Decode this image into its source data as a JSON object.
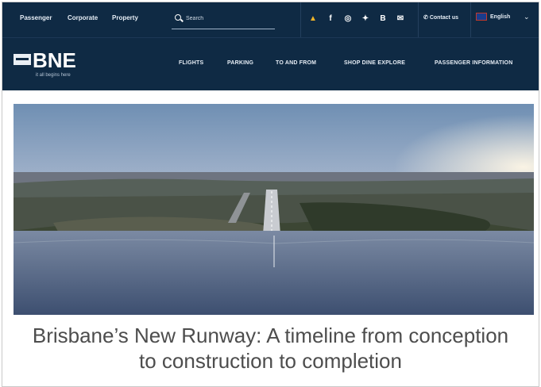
{
  "topbar": {
    "links": [
      "Passenger",
      "Corporate",
      "Property"
    ],
    "search_placeholder": "Search",
    "icons": [
      "alert-icon",
      "facebook-icon",
      "instagram-icon",
      "twitter-icon",
      "blog-icon",
      "mail-icon"
    ],
    "contact_label": "Contact us",
    "language_label": "English"
  },
  "brand": {
    "logo_text": "BNE",
    "tagline": "it all begins here"
  },
  "nav": {
    "items": [
      "FLIGHTS",
      "PARKING",
      "TO AND FROM",
      "SHOP DINE EXPLORE",
      "PASSENGER INFORMATION"
    ]
  },
  "article": {
    "headline_line1": "Brisbane’s New Runway: A timeline from conception",
    "headline_line2": "to construction to completion"
  },
  "colors": {
    "header_bg": "#0f2a44",
    "headline_text": "#4d4d4d"
  }
}
